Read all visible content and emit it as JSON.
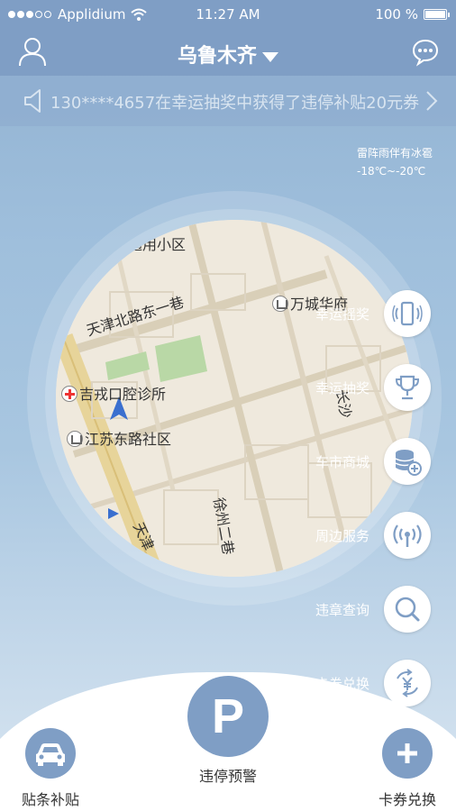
{
  "status": {
    "carrier": "Applidium",
    "time": "11:27 AM",
    "battery": "100 %"
  },
  "nav": {
    "city": "乌鲁木齐"
  },
  "notice": {
    "text": "130****4657在幸运抽奖中获得了违停补贴20元券"
  },
  "weather": {
    "condition": "雷阵雨伴有冰雹",
    "temp": "-18℃~-20℃"
  },
  "map": {
    "labels": {
      "tongyong": "通用小区",
      "wancheng": "万城华府",
      "tianjin_north": "天津北路东一巷",
      "clinic": "吉戎口腔诊所",
      "jiangsu": "江苏东路社区",
      "xuzhou": "徐州二巷",
      "tianjin": "天津",
      "changsha": "长沙"
    }
  },
  "menu": [
    {
      "label": "幸运摇奖",
      "icon": "phone-shake-icon"
    },
    {
      "label": "幸运抽奖",
      "icon": "trophy-icon"
    },
    {
      "label": "车市商城",
      "icon": "coins-icon"
    },
    {
      "label": "周边服务",
      "icon": "signal-icon"
    },
    {
      "label": "违章查询",
      "icon": "search-icon"
    },
    {
      "label": "卡券兑换",
      "icon": "yen-exchange-icon"
    }
  ],
  "tabs": {
    "left": "贴条补贴",
    "center": "违停预警",
    "center_glyph": "P",
    "right": "卡券兑换"
  },
  "colors": {
    "primary": "#7f9ec5",
    "icon_blue": "#7f9ec5"
  }
}
